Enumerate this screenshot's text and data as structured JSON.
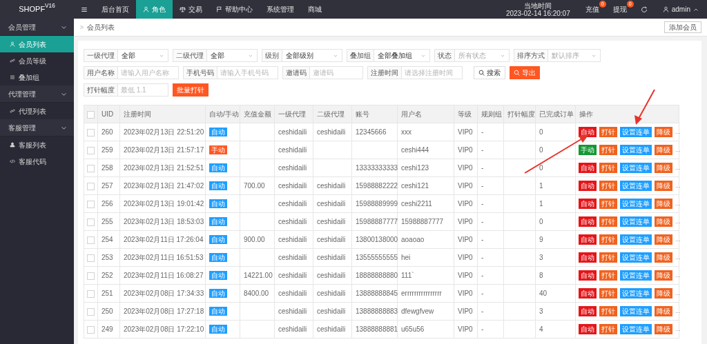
{
  "logo": "SHOPF$^{V16}$",
  "top_nav": [
    {
      "label": "后台首页",
      "selected": false
    },
    {
      "label": "角色",
      "selected": true
    },
    {
      "label": "交易",
      "selected": false
    },
    {
      "label": "帮助中心",
      "selected": false
    },
    {
      "label": "系统管理",
      "selected": false
    },
    {
      "label": "商城",
      "selected": false
    }
  ],
  "clock": {
    "label": "当地时间",
    "time": "2023-02-14 16:20:07"
  },
  "top_actions": [
    {
      "label": "充值",
      "badge": "0"
    },
    {
      "label": "提现",
      "badge": "0"
    }
  ],
  "user": {
    "name": "admin"
  },
  "sidebar": [
    {
      "label": "会员管理",
      "expanded": true,
      "children": [
        {
          "label": "会员列表",
          "selected": true
        },
        {
          "label": "会员等级",
          "selected": false
        },
        {
          "label": "叠加组",
          "selected": false
        }
      ]
    },
    {
      "label": "代理管理",
      "expanded": true,
      "children": [
        {
          "label": "代理列表",
          "selected": false
        }
      ]
    },
    {
      "label": "客服管理",
      "expanded": true,
      "children": [
        {
          "label": "客服列表",
          "selected": false
        },
        {
          "label": "客服代码",
          "selected": false
        }
      ]
    }
  ],
  "breadcrumb": "会员列表",
  "add_button": "添加会员",
  "filters": [
    [
      {
        "kind": "select",
        "label": "一级代理",
        "value": "全部"
      },
      {
        "kind": "select",
        "label": "二级代理",
        "value": "全部"
      },
      {
        "kind": "select",
        "label": "级别",
        "value": "全部级别"
      },
      {
        "kind": "select",
        "label": "叠加组",
        "value": "全部叠加组"
      },
      {
        "kind": "select",
        "label": "状态",
        "placeholder": "所有状态"
      },
      {
        "kind": "select",
        "label": "排序方式",
        "placeholder": "默认排序"
      }
    ],
    [
      {
        "kind": "input",
        "label": "用户名称",
        "placeholder": "请输入用户名称"
      },
      {
        "kind": "input",
        "label": "手机号码",
        "placeholder": "请输入手机号码"
      },
      {
        "kind": "input",
        "label": "邀请码",
        "placeholder": "邀请码"
      },
      {
        "kind": "input",
        "label": "注册时间",
        "placeholder": "请选择注册时间"
      },
      {
        "kind": "search",
        "label": "搜索"
      },
      {
        "kind": "export",
        "label": "导出"
      }
    ],
    [
      {
        "kind": "input",
        "label": "打针幅度",
        "placeholder": "最低 1.1"
      },
      {
        "kind": "batch",
        "label": "批量打针"
      }
    ]
  ],
  "table": {
    "select_all": {
      "checked": false
    },
    "columns": [
      "UID",
      "注册时间",
      "自动/手动",
      "充值金额",
      "一级代理",
      "二级代理",
      "账号",
      "用户名",
      "等级",
      "规则组",
      "打针幅度",
      "已完成订单",
      "操作"
    ],
    "rows": [
      {
        "checked": false,
        "uid": "260",
        "time": "2023年02月13日 22:51:20",
        "manual": false,
        "mode_label": "自动",
        "agent1": "ceshidaili",
        "agent2": "ceshidaili",
        "account": "12345666",
        "username": "xxx",
        "level": "VIP0",
        "rule_group": "-",
        "completed": "0",
        "actions": [
          {
            "kind": "auto",
            "label": "自动"
          },
          {
            "kind": "inject",
            "label": "打针"
          },
          {
            "kind": "chain",
            "label": "设置连单"
          },
          {
            "kind": "down",
            "label": "降级"
          }
        ],
        "more": "..."
      },
      {
        "checked": false,
        "uid": "259",
        "time": "2023年02月13日 21:57:17",
        "manual": true,
        "mode_label": "手动",
        "agent1": "ceshidaili",
        "username": "ceshi444",
        "level": "VIP0",
        "rule_group": "-",
        "completed": "0",
        "actions": [
          {
            "kind": "manual",
            "label": "手动"
          },
          {
            "kind": "inject",
            "label": "打针"
          },
          {
            "kind": "chain",
            "label": "设置连单"
          },
          {
            "kind": "down",
            "label": "降级"
          }
        ],
        "more": "..."
      },
      {
        "checked": false,
        "uid": "258",
        "time": "2023年02月13日 21:52:51",
        "manual": false,
        "mode_label": "自动",
        "agent1": "ceshidaili",
        "account": "13333333333",
        "username": "ceshi123",
        "level": "VIP0",
        "rule_group": "-",
        "completed": "0",
        "actions": [
          {
            "kind": "auto",
            "label": "自动"
          },
          {
            "kind": "inject",
            "label": "打针"
          },
          {
            "kind": "chain",
            "label": "设置连单"
          },
          {
            "kind": "down",
            "label": "降级"
          }
        ],
        "more": "..."
      },
      {
        "checked": false,
        "uid": "257",
        "time": "2023年02月13日 21:47:02",
        "manual": false,
        "mode_label": "自动",
        "amount": "700.00",
        "agent1": "ceshidaili",
        "agent2": "ceshidaili",
        "account": "15988882222",
        "username": "ceshi121",
        "level": "VIP0",
        "rule_group": "-",
        "completed": "1",
        "actions": [
          {
            "kind": "auto",
            "label": "自动"
          },
          {
            "kind": "inject",
            "label": "打针"
          },
          {
            "kind": "chain",
            "label": "设置连单"
          },
          {
            "kind": "down",
            "label": "降级"
          }
        ],
        "more": "..."
      },
      {
        "checked": false,
        "uid": "256",
        "time": "2023年02月13日 19:01:42",
        "manual": false,
        "mode_label": "自动",
        "agent1": "ceshidaili",
        "agent2": "ceshidaili",
        "account": "15988889999",
        "username": "ceshi2211",
        "level": "VIP0",
        "rule_group": "-",
        "completed": "1",
        "actions": [
          {
            "kind": "auto",
            "label": "自动"
          },
          {
            "kind": "inject",
            "label": "打针"
          },
          {
            "kind": "chain",
            "label": "设置连单"
          },
          {
            "kind": "down",
            "label": "降级"
          }
        ],
        "more": "..."
      },
      {
        "checked": false,
        "uid": "255",
        "time": "2023年02月13日 18:53:03",
        "manual": false,
        "mode_label": "自动",
        "agent1": "ceshidaili",
        "agent2": "ceshidaili",
        "account": "15988887777",
        "username": "15988887777",
        "level": "VIP0",
        "rule_group": "-",
        "completed": "0",
        "actions": [
          {
            "kind": "auto",
            "label": "自动"
          },
          {
            "kind": "inject",
            "label": "打针"
          },
          {
            "kind": "chain",
            "label": "设置连单"
          },
          {
            "kind": "down",
            "label": "降级"
          }
        ],
        "more": "..."
      },
      {
        "checked": false,
        "uid": "254",
        "time": "2023年02月11日 17:26:04",
        "manual": false,
        "mode_label": "自动",
        "amount": "900.00",
        "agent1": "ceshidaili",
        "agent2": "ceshidaili",
        "account": "13800138000",
        "username": "aoaoao",
        "level": "VIP0",
        "rule_group": "-",
        "completed": "9",
        "actions": [
          {
            "kind": "auto",
            "label": "自动"
          },
          {
            "kind": "inject",
            "label": "打针"
          },
          {
            "kind": "chain",
            "label": "设置连单"
          },
          {
            "kind": "down",
            "label": "降级"
          }
        ],
        "more": "..."
      },
      {
        "checked": false,
        "uid": "253",
        "time": "2023年02月11日 16:51:53",
        "manual": false,
        "mode_label": "自动",
        "agent1": "ceshidaili",
        "agent2": "ceshidaili",
        "account": "13555555555",
        "username": "hei",
        "level": "VIP0",
        "rule_group": "-",
        "completed": "3",
        "actions": [
          {
            "kind": "auto",
            "label": "自动"
          },
          {
            "kind": "inject",
            "label": "打针"
          },
          {
            "kind": "chain",
            "label": "设置连单"
          },
          {
            "kind": "down",
            "label": "降级"
          }
        ],
        "more": "..."
      },
      {
        "checked": false,
        "uid": "252",
        "time": "2023年02月11日 16:08:27",
        "manual": false,
        "mode_label": "自动",
        "amount": "14221.00",
        "agent1": "ceshidaili",
        "agent2": "ceshidaili",
        "account": "18888888880",
        "username": "111`",
        "level": "VIP0",
        "rule_group": "-",
        "completed": "8",
        "actions": [
          {
            "kind": "auto",
            "label": "自动"
          },
          {
            "kind": "inject",
            "label": "打针"
          },
          {
            "kind": "chain",
            "label": "设置连单"
          },
          {
            "kind": "down",
            "label": "降级"
          }
        ],
        "more": "..."
      },
      {
        "checked": false,
        "uid": "251",
        "time": "2023年02月08日 17:34:33",
        "manual": false,
        "mode_label": "自动",
        "amount": "8400.00",
        "agent1": "ceshidaili",
        "agent2": "ceshidaili",
        "account": "13888888845",
        "username": "errrrrrrrrrrrrrrr",
        "level": "VIP0",
        "rule_group": "-",
        "completed": "40",
        "actions": [
          {
            "kind": "auto",
            "label": "自动"
          },
          {
            "kind": "inject",
            "label": "打针"
          },
          {
            "kind": "chain",
            "label": "设置连单"
          },
          {
            "kind": "down",
            "label": "降级"
          }
        ],
        "more": "..."
      },
      {
        "checked": false,
        "uid": "250",
        "time": "2023年02月08日 17:27:18",
        "manual": false,
        "mode_label": "自动",
        "agent1": "ceshidaili",
        "agent2": "ceshidaili",
        "account": "13888888883",
        "username": "dfewgfvew",
        "level": "VIP0",
        "rule_group": "-",
        "completed": "3",
        "actions": [
          {
            "kind": "auto",
            "label": "自动"
          },
          {
            "kind": "inject",
            "label": "打针"
          },
          {
            "kind": "chain",
            "label": "设置连单"
          },
          {
            "kind": "down",
            "label": "降级"
          }
        ],
        "more": "..."
      },
      {
        "checked": false,
        "uid": "249",
        "time": "2023年02月08日 17:22:10",
        "manual": false,
        "mode_label": "自动",
        "agent1": "ceshidaili",
        "agent2": "ceshidaili",
        "account": "13888888881",
        "username": "u65u56",
        "level": "VIP0",
        "rule_group": "-",
        "completed": "4",
        "actions": [
          {
            "kind": "auto",
            "label": "自动"
          },
          {
            "kind": "inject",
            "label": "打针"
          },
          {
            "kind": "chain",
            "label": "设置连单"
          },
          {
            "kind": "down",
            "label": "降级"
          }
        ],
        "more": "..."
      }
    ]
  }
}
